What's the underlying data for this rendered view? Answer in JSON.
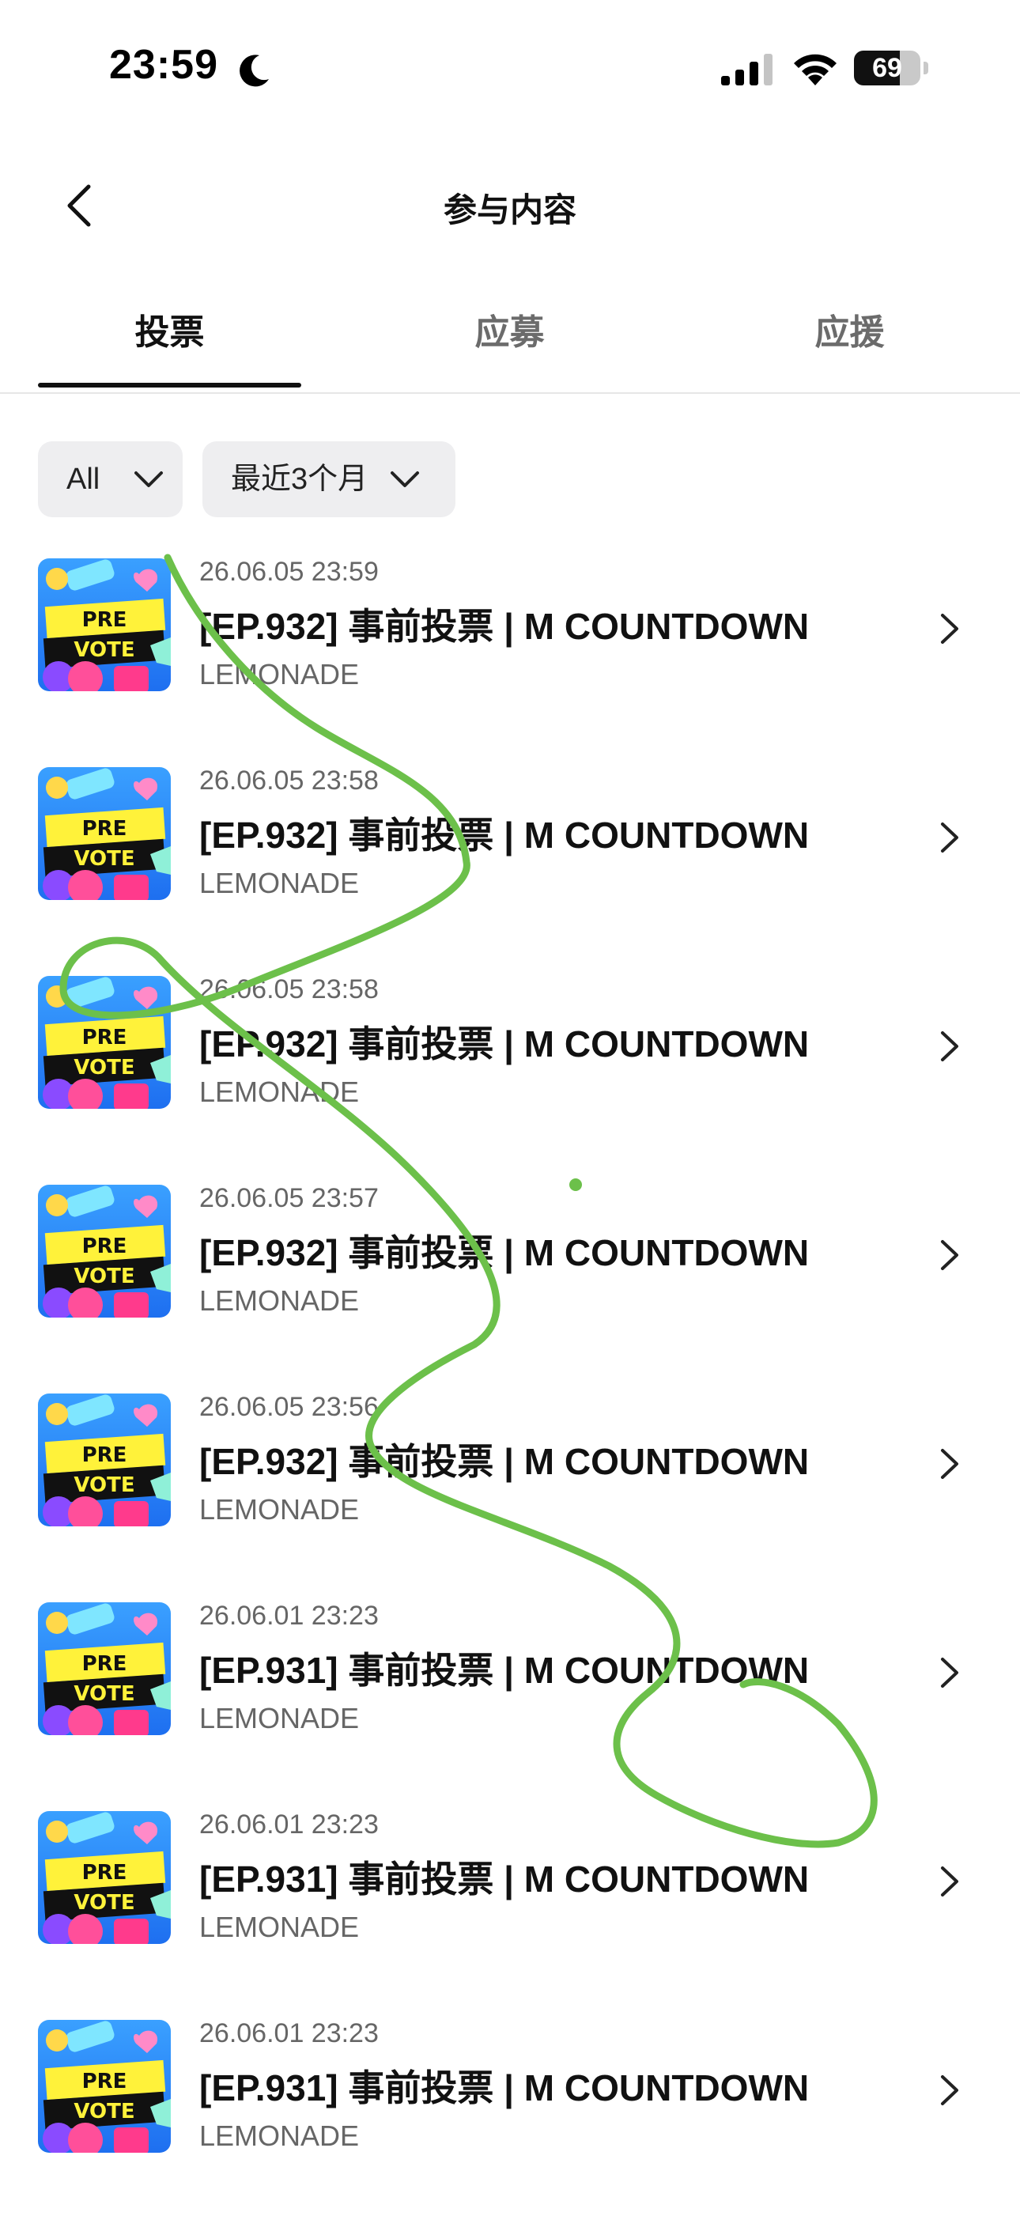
{
  "status_bar": {
    "time": "23:59",
    "battery": "69",
    "battery_level": 0.69,
    "icons": [
      "moon-icon",
      "signal-icon",
      "wifi-icon",
      "battery-icon"
    ]
  },
  "header": {
    "title": "参与内容",
    "back_icon": "chevron-left-icon"
  },
  "tabs": [
    {
      "label": "投票",
      "active": true
    },
    {
      "label": "应募",
      "active": false
    },
    {
      "label": "应援",
      "active": false
    }
  ],
  "filters": [
    {
      "label": "All",
      "icon": "chevron-down-icon"
    },
    {
      "label": "最近3个月",
      "icon": "chevron-down-icon"
    }
  ],
  "items": [
    {
      "date": "26.06.05 23:59",
      "title": "[EP.932] 事前投票 | M COUNTDOWN",
      "sub": "LEMONADE"
    },
    {
      "date": "26.06.05 23:58",
      "title": "[EP.932] 事前投票 | M COUNTDOWN",
      "sub": "LEMONADE"
    },
    {
      "date": "26.06.05 23:58",
      "title": "[EP.932] 事前投票 | M COUNTDOWN",
      "sub": "LEMONADE"
    },
    {
      "date": "26.06.05 23:57",
      "title": "[EP.932] 事前投票 | M COUNTDOWN",
      "sub": "LEMONADE"
    },
    {
      "date": "26.06.05 23:56",
      "title": "[EP.932] 事前投票 | M COUNTDOWN",
      "sub": "LEMONADE"
    },
    {
      "date": "26.06.01 23:23",
      "title": "[EP.931] 事前投票 | M COUNTDOWN",
      "sub": "LEMONADE"
    },
    {
      "date": "26.06.01 23:23",
      "title": "[EP.931] 事前投票 | M COUNTDOWN",
      "sub": "LEMONADE"
    },
    {
      "date": "26.06.01 23:23",
      "title": "[EP.931] 事前投票 | M COUNTDOWN",
      "sub": "LEMONADE"
    }
  ],
  "thumbnail": {
    "line1": "PRE",
    "line2": "VOTE"
  },
  "colors": {
    "accent": "#111111",
    "scribble": "#6cc04a",
    "chip_bg": "#eeeef0"
  }
}
